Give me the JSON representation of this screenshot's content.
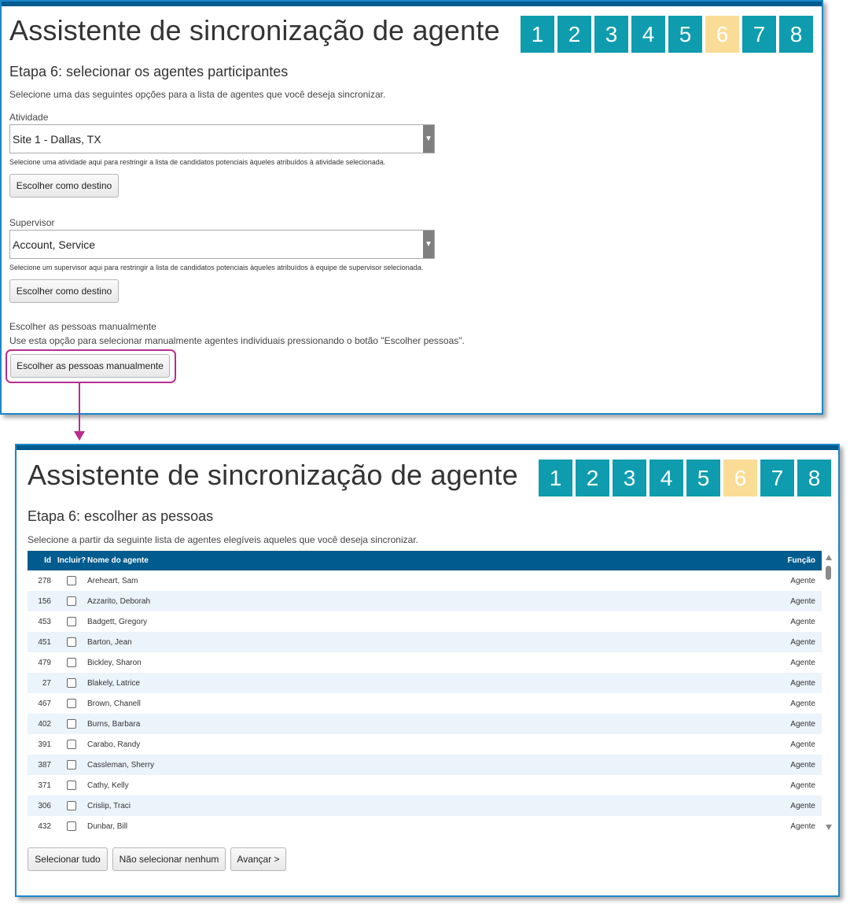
{
  "colors": {
    "accent": "#0e9cae",
    "active_step": "#fbdc96",
    "header": "#005b8e",
    "highlight": "#b82d8f"
  },
  "top_panel": {
    "title": "Assistente de sincronização de agente",
    "steps": [
      "1",
      "2",
      "3",
      "4",
      "5",
      "6",
      "7",
      "8"
    ],
    "active_step": "6",
    "subtitle": "Etapa 6: selecionar os agentes participantes",
    "intro": "Selecione uma das seguintes opções para a lista de agentes que você deseja sincronizar.",
    "activity": {
      "label": "Atividade",
      "value": "Site 1 - Dallas, TX",
      "help": "Selecione uma atividade aqui para restringir a lista de candidatos potenciais àqueles atribuídos à atividade selecionada.",
      "button": "Escolher como destino"
    },
    "supervisor": {
      "label": "Supervisor",
      "value": "Account, Service",
      "help": "Selecione um supervisor aqui para restringir a lista de candidatos potenciais àqueles atribuídos à equipe de supervisor selecionada.",
      "button": "Escolher como destino"
    },
    "manual": {
      "label": "Escolher as pessoas manualmente",
      "help": "Use esta opção para selecionar manualmente agentes individuais pressionando o botão \"Escolher pessoas\".",
      "button": "Escolher as pessoas manualmente"
    }
  },
  "bottom_panel": {
    "title": "Assistente de sincronização de agente",
    "steps": [
      "1",
      "2",
      "3",
      "4",
      "5",
      "6",
      "7",
      "8"
    ],
    "active_step": "6",
    "subtitle": "Etapa 6: escolher as pessoas",
    "intro": "Selecione a partir da seguinte lista de agentes elegíveis aqueles que você deseja sincronizar.",
    "table": {
      "columns": [
        "Id",
        "Incluir?",
        "Nome do agente",
        "Função"
      ],
      "rows": [
        {
          "id": "278",
          "name": "Areheart, Sam",
          "func": "Agente"
        },
        {
          "id": "156",
          "name": "Azzarito, Deborah",
          "func": "Agente"
        },
        {
          "id": "453",
          "name": "Badgett, Gregory",
          "func": "Agente"
        },
        {
          "id": "451",
          "name": "Barton, Jean",
          "func": "Agente"
        },
        {
          "id": "479",
          "name": "Bickley, Sharon",
          "func": "Agente"
        },
        {
          "id": "27",
          "name": "Blakely, Latrice",
          "func": "Agente"
        },
        {
          "id": "467",
          "name": "Brown, Chanell",
          "func": "Agente"
        },
        {
          "id": "402",
          "name": "Burns, Barbara",
          "func": "Agente"
        },
        {
          "id": "391",
          "name": "Carabo, Randy",
          "func": "Agente"
        },
        {
          "id": "387",
          "name": "Cassleman, Sherry",
          "func": "Agente"
        },
        {
          "id": "371",
          "name": "Cathy, Kelly",
          "func": "Agente"
        },
        {
          "id": "306",
          "name": "Crislip, Traci",
          "func": "Agente"
        },
        {
          "id": "432",
          "name": "Dunbar, Bill",
          "func": "Agente"
        }
      ]
    },
    "buttons": {
      "select_all": "Selecionar tudo",
      "select_none": "Não selecionar nenhum",
      "next": "Avançar >"
    }
  }
}
